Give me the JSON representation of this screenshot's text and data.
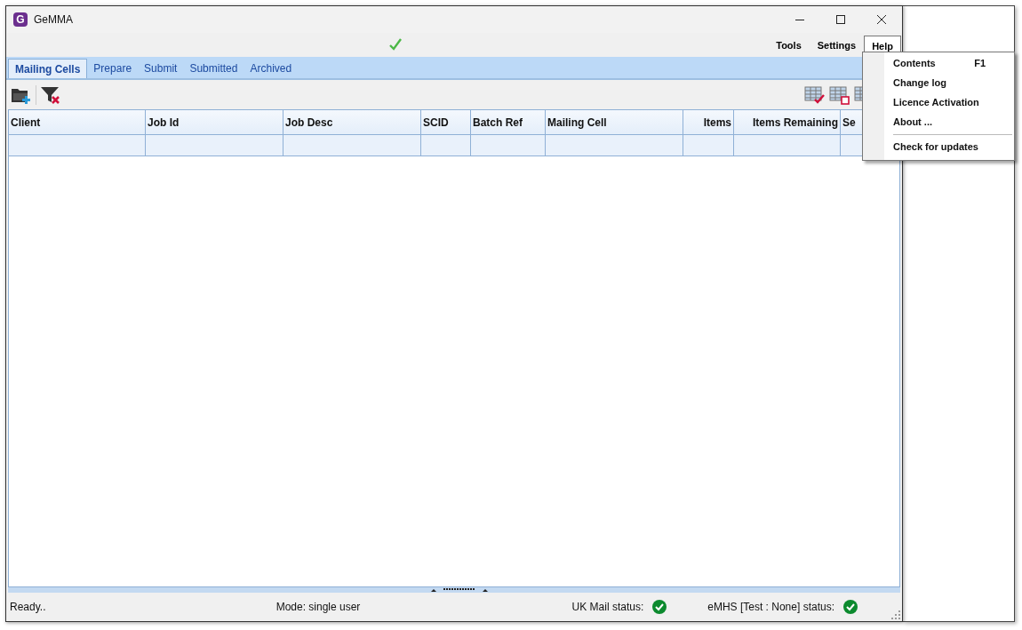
{
  "window": {
    "title": "GeMMA",
    "app_icon_letter": "G"
  },
  "menu_bar": [
    {
      "label": "Tools",
      "selected": false
    },
    {
      "label": "Settings",
      "selected": false
    },
    {
      "label": "Help",
      "selected": true
    }
  ],
  "help_menu": [
    {
      "kind": "item",
      "label": "Contents",
      "shortcut": "F1"
    },
    {
      "kind": "item",
      "label": "Change log"
    },
    {
      "kind": "item",
      "label": "Licence Activation"
    },
    {
      "kind": "item",
      "label": "About ..."
    },
    {
      "kind": "separator"
    },
    {
      "kind": "item",
      "label": "Check for updates"
    }
  ],
  "tabs": [
    {
      "label": "Mailing Cells",
      "selected": true
    },
    {
      "label": "Prepare",
      "selected": false
    },
    {
      "label": "Submit",
      "selected": false
    },
    {
      "label": "Submitted",
      "selected": false
    },
    {
      "label": "Archived",
      "selected": false
    }
  ],
  "table": {
    "columns": [
      {
        "label": "Client",
        "kind": "text"
      },
      {
        "label": "Job Id",
        "kind": "text"
      },
      {
        "label": "Job Desc",
        "kind": "text"
      },
      {
        "label": "SCID",
        "kind": "text"
      },
      {
        "label": "Batch Ref",
        "kind": "text"
      },
      {
        "label": "Mailing Cell",
        "kind": "text"
      },
      {
        "label": "Items",
        "kind": "number"
      },
      {
        "label": "Items Remaining",
        "kind": "number"
      },
      {
        "label": "Se",
        "kind": "text"
      }
    ]
  },
  "status_bar": {
    "message": "Ready..",
    "mode": "Mode: single user",
    "services": [
      {
        "label": "UK Mail status:",
        "ok": true
      },
      {
        "label": "eMHS [Test : None] status:",
        "ok": true
      }
    ]
  }
}
